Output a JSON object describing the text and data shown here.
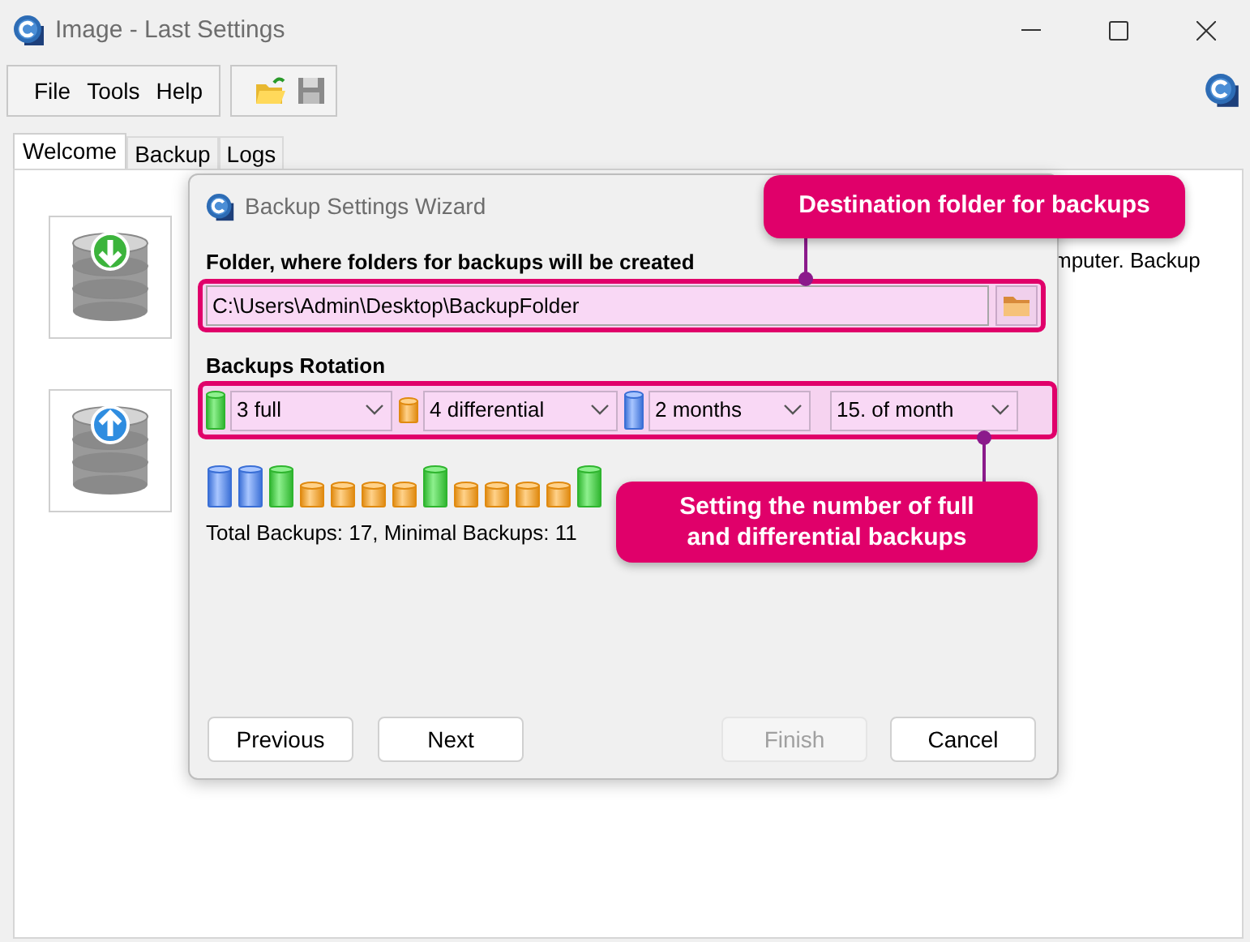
{
  "window": {
    "title": "Image - Last Settings"
  },
  "menu": [
    "File",
    "Tools",
    "Help"
  ],
  "tabs": [
    {
      "label": "Welcome",
      "selected": true
    },
    {
      "label": "Backup",
      "selected": false
    },
    {
      "label": "Logs",
      "selected": false
    }
  ],
  "welcome_text": "mputer. Backup",
  "dialog": {
    "title": "Backup Settings Wizard",
    "folder_label": "Folder, where folders for backups will be created",
    "folder_value": "C:\\Users\\Admin\\Desktop\\BackupFolder",
    "rotation_label": "Backups Rotation",
    "selects": [
      {
        "kind": "full",
        "value": "3 full"
      },
      {
        "kind": "differential",
        "value": "4 differential"
      },
      {
        "kind": "period",
        "value": "2 months"
      },
      {
        "kind": "none",
        "value": "15. of month"
      }
    ],
    "backups": [
      {
        "kind": "period"
      },
      {
        "kind": "period"
      },
      {
        "kind": "full"
      },
      {
        "kind": "differential"
      },
      {
        "kind": "differential"
      },
      {
        "kind": "differential"
      },
      {
        "kind": "differential"
      },
      {
        "kind": "full"
      },
      {
        "kind": "differential"
      },
      {
        "kind": "differential"
      },
      {
        "kind": "differential"
      },
      {
        "kind": "differential"
      },
      {
        "kind": "full"
      }
    ],
    "summary": "Total Backups: 17, Minimal Backups: 11",
    "buttons": [
      {
        "label": "Previous",
        "disabled": false
      },
      {
        "label": "Next",
        "disabled": false
      },
      {
        "label": "Finish",
        "disabled": true
      },
      {
        "label": "Cancel",
        "disabled": false
      }
    ]
  },
  "callouts": [
    "Destination folder for backups",
    "Setting the number of full and differential backups"
  ]
}
